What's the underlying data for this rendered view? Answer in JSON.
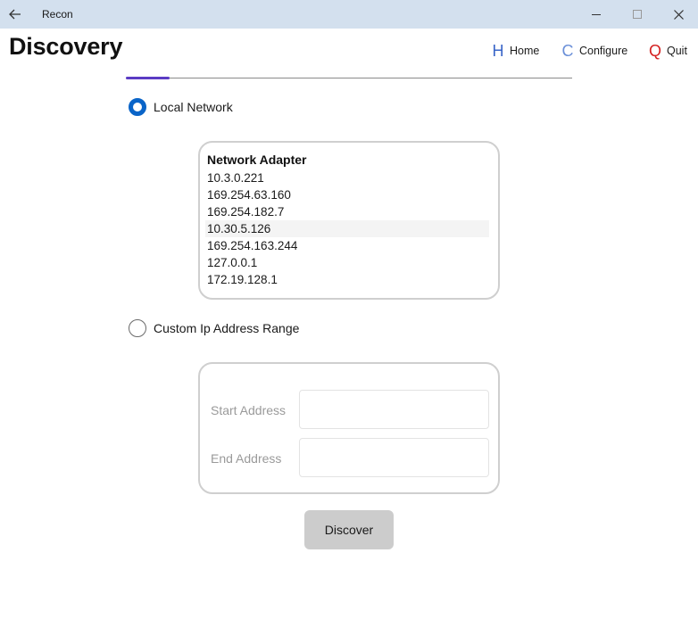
{
  "window": {
    "title": "Recon",
    "back_icon": "arrow-left-icon",
    "minimize_icon": "minimize-icon",
    "maximize_icon": "maximize-icon",
    "close_icon": "close-icon"
  },
  "page": {
    "title": "Discovery"
  },
  "nav": [
    {
      "key": "H",
      "label": "Home",
      "color": "#3a66c8"
    },
    {
      "key": "C",
      "label": "Configure",
      "color": "#6a8fd8"
    },
    {
      "key": "Q",
      "label": "Quit",
      "color": "#d42020"
    }
  ],
  "options": {
    "local": {
      "label": "Local Network",
      "selected": true
    },
    "custom": {
      "label": "Custom Ip Address Range",
      "selected": false
    }
  },
  "adapters": {
    "header": "Network Adapter",
    "items": [
      "10.3.0.221",
      "169.254.63.160",
      "169.254.182.7",
      "10.30.5.126",
      "169.254.163.244",
      "127.0.0.1",
      "172.19.128.1"
    ]
  },
  "range": {
    "start_label": "Start Address",
    "start_value": "",
    "end_label": "End Address",
    "end_value": ""
  },
  "actions": {
    "discover_label": "Discover"
  },
  "colors": {
    "accent": "#5b3cc4",
    "radio": "#0a64c8",
    "titlebar": "#d3e0ee"
  }
}
